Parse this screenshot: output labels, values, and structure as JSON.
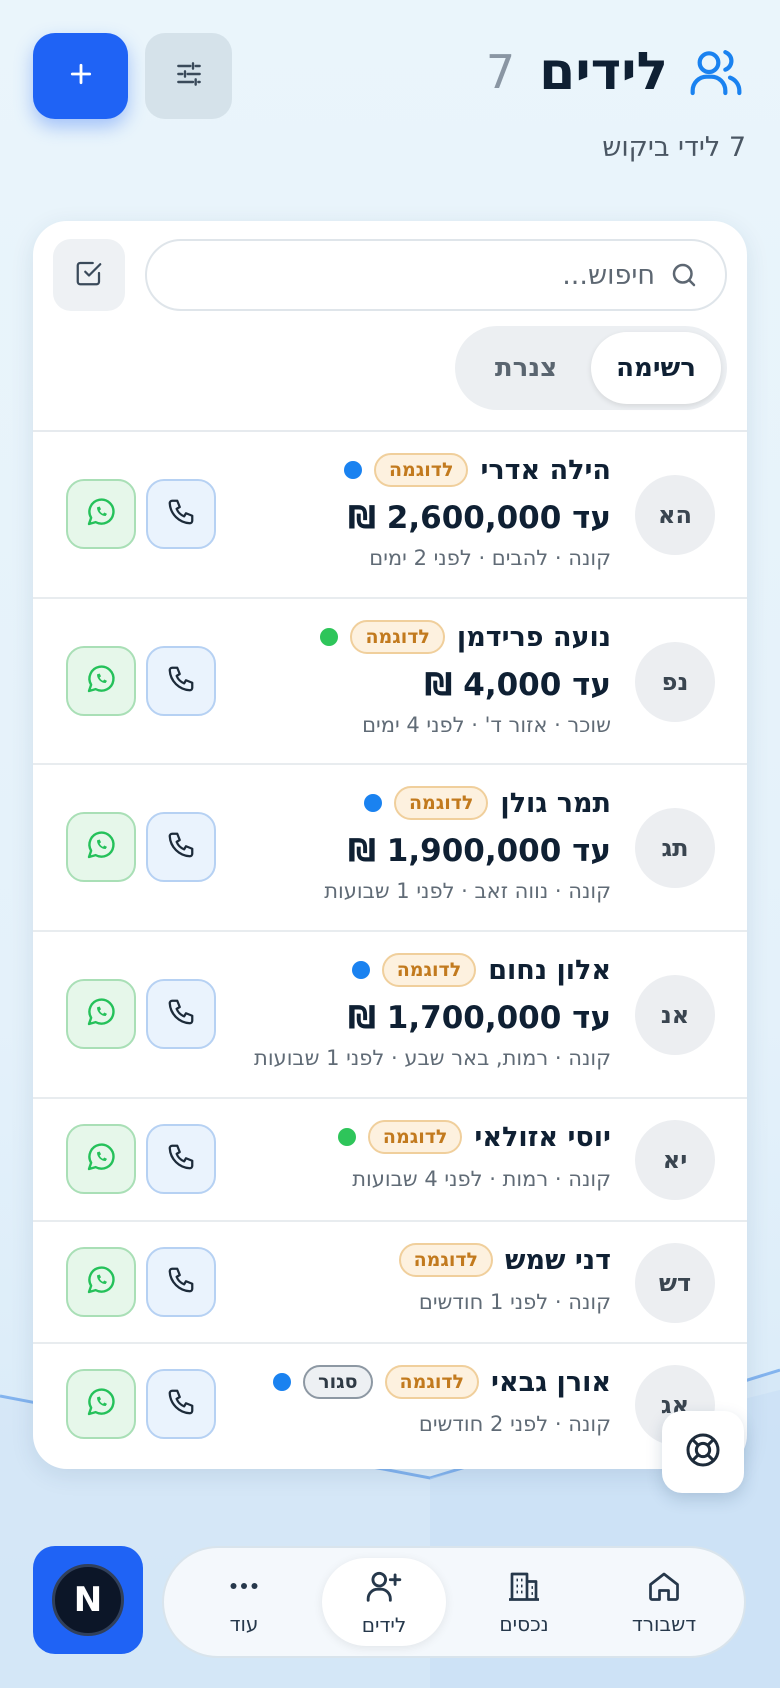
{
  "header": {
    "title": "לידים",
    "count": "7",
    "subtitle": "7 לידי ביקוש"
  },
  "search": {
    "placeholder": "חיפוש..."
  },
  "view_tabs": [
    {
      "label": "רשימה",
      "active": true
    },
    {
      "label": "צנרת",
      "active": false
    }
  ],
  "leads": [
    {
      "initials": "הא",
      "name": "הילה אדרי",
      "badge": "לדוגמה",
      "status_badge": "",
      "dot_color": "#1a82f0",
      "budget": "עד 2,600,000 ₪",
      "meta": "קונה · להבים · לפני 2 ימים"
    },
    {
      "initials": "נפ",
      "name": "נועה פרידמן",
      "badge": "לדוגמה",
      "status_badge": "",
      "dot_color": "#2ec55a",
      "budget": "עד 4,000 ₪",
      "meta": "שוכר · אזור ד' · לפני 4 ימים"
    },
    {
      "initials": "תג",
      "name": "תמר גולן",
      "badge": "לדוגמה",
      "status_badge": "",
      "dot_color": "#1a82f0",
      "budget": "עד 1,900,000 ₪",
      "meta": "קונה · נווה זאב · לפני 1 שבועות"
    },
    {
      "initials": "אנ",
      "name": "אלון נחום",
      "badge": "לדוגמה",
      "status_badge": "",
      "dot_color": "#1a82f0",
      "budget": "עד 1,700,000 ₪",
      "meta": "קונה · רמות, באר שבע · לפני 1 שבועות"
    },
    {
      "initials": "יא",
      "name": "יוסי אזולאי",
      "badge": "לדוגמה",
      "status_badge": "",
      "dot_color": "#2ec55a",
      "budget": "",
      "meta": "קונה · רמות · לפני 4 שבועות"
    },
    {
      "initials": "דש",
      "name": "דני שמש",
      "badge": "לדוגמה",
      "status_badge": "",
      "dot_color": "",
      "budget": "",
      "meta": "קונה · לפני 1 חודשים"
    },
    {
      "initials": "אג",
      "name": "אורן גבאי",
      "badge": "לדוגמה",
      "status_badge": "סגור",
      "dot_color": "#1a82f0",
      "budget": "",
      "meta": "קונה · לפני 2 חודשים"
    }
  ],
  "bottom_nav": [
    {
      "label": "דשבורד",
      "icon": "home-icon",
      "active": false
    },
    {
      "label": "נכסים",
      "icon": "building-icon",
      "active": false
    },
    {
      "label": "לידים",
      "icon": "user-plus-icon",
      "active": true
    },
    {
      "label": "עוד",
      "icon": "more-icon",
      "active": false
    }
  ],
  "brand": {
    "logo_letter": "N"
  },
  "colors": {
    "accent": "#1f63f5",
    "badge_text": "#c27a1e",
    "whatsapp": "#25c15a",
    "blue_dot": "#1a82f0",
    "green_dot": "#2ec55a"
  }
}
